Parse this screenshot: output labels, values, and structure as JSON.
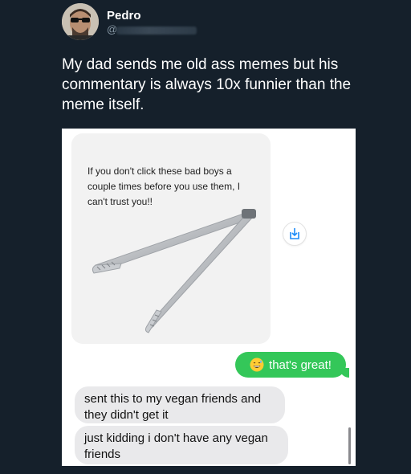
{
  "author": {
    "name": "Pedro",
    "handle_prefix": "@"
  },
  "tweet": {
    "text": "My dad sends me old ass memes but his commentary is always 10x funnier than the meme itself."
  },
  "screenshot": {
    "meme_caption": "If you don't click these bad boys a couple times before you use them, I can't trust you!!",
    "messages": [
      {
        "from": "me",
        "text": "that's great!",
        "emoji": "grinning-sweat-face-icon"
      },
      {
        "from": "dad",
        "text": "sent this to my vegan friends and they didn't get it"
      },
      {
        "from": "dad",
        "text": "just kidding i don't have any vegan friends"
      }
    ],
    "colors": {
      "sent_bubble": "#34c759",
      "received_bubble": "#e9e9eb",
      "page_background": "#15202b"
    }
  }
}
